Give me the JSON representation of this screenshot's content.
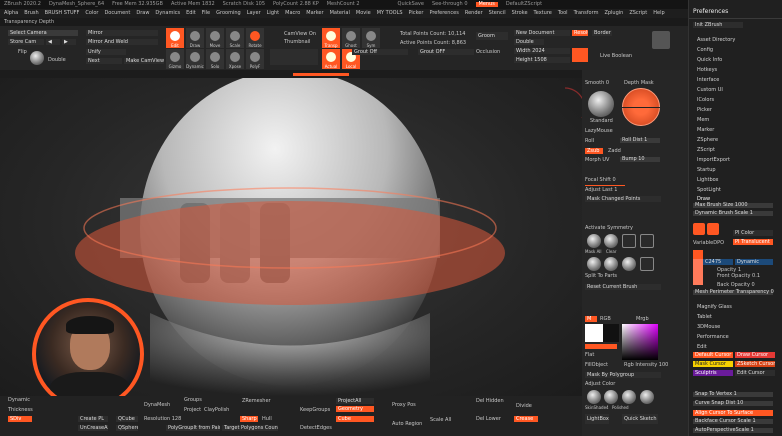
{
  "titlebar": {
    "items": [
      "ZBrush 2020.2",
      "DynaMesh_Sphere_64",
      "Free Mem 32.935GB",
      "Active Mem 1832",
      "Scratch Disk 105",
      "PolyCount 2.88 KP",
      "MeshCount 2"
    ],
    "quicksave": "QuickSave",
    "see_through": "See-through 0",
    "menus": "Menus",
    "default_script": "DefaultZScript"
  },
  "menubar": {
    "items": [
      "Alpha",
      "Brush",
      "BRUSH STUFF",
      "Color",
      "Document",
      "Draw",
      "Dynamics",
      "Edit",
      "File",
      "Grooming",
      "Layer",
      "Light",
      "Macro",
      "Marker",
      "Material",
      "Movie",
      "MY TOOLS",
      "Picker",
      "Preferences",
      "Render",
      "Stencil",
      "Stroke",
      "Texture",
      "Tool",
      "Transform",
      "Zplugin",
      "ZScript",
      "Help"
    ]
  },
  "subbar": {
    "label": "Transparency Depth"
  },
  "toptools": {
    "select_camera": "Select Camera",
    "store_cam": "Store Cam",
    "flip": "Flip",
    "double": "Double",
    "mirror": "Mirror",
    "mirror_weld": "Mirror And Weld",
    "unify": "Unify",
    "next": "Next",
    "make_camview": "Make CamView",
    "camview_on": "CamView On",
    "thumbnail": "Thumbnail",
    "total_points": "Total Points Count: 10,114",
    "active_points": "Active Points Count: 8,863",
    "grooming": "Groom",
    "resolution": "Resolution",
    "new_document": "New Document",
    "border": "Border",
    "width": "Width 2024",
    "height": "Height 1508",
    "live_boolean": "Live Boolean",
    "grout": "Grout Off",
    "grout2": "Grout OFF",
    "tool_labels": [
      "Edit",
      "Draw",
      "Move",
      "Scale",
      "Rotate",
      "Gizmo",
      "Dynamic",
      "Solo",
      "Xpose",
      "PolyF",
      "Transp",
      "Ghost",
      "Actual",
      "Local",
      "Sym"
    ],
    "occlusion": "Occlusion",
    "double2": "Double"
  },
  "rshelf": {
    "groups": "Smooth 0",
    "depth_mask": "Depth Mask",
    "standard": "Standard",
    "lazy_mouse": "LazyMouse",
    "roll": "Roll",
    "roll_dist": "Roll Dist 1",
    "zsub": "Zsub",
    "zadd": "Zadd",
    "morph_uv": "Morph UV",
    "bump": "Bump 10",
    "focal_shift": "Focal Shift 0",
    "adjust_last": "Adjust Last 1",
    "mask_changed": "Mask Changed Points",
    "activate_symmetry": "Activate Symmetry",
    "mask_all": "Mask All",
    "clear": "Clear",
    "sel_lasso": "SelectLasso",
    "sel_rect": "SelectRect",
    "clip_curve": "ClipCurve",
    "split_to_parts": "Split To Parts",
    "reset_current_brush": "Reset Current Brush",
    "rgb": "RGB",
    "mrgb": "Mrgb",
    "m": "M",
    "fill_object": "FillObject",
    "rgb_intensity": "Rgb Intensity 100",
    "mask_by_polygroup": "Mask By Polygroup",
    "adjust_color": "Adjust Color",
    "lightbox": "LightBox",
    "quick_sketch": "Quick Sketch",
    "materials": [
      "SkinShade4",
      "Polished",
      "BasicMat",
      "BasicMat2"
    ],
    "gradient": "Gradient",
    "flat": "Flat",
    "split": "Split",
    "subtool_label": "Sculptris Pro",
    "alpha_label": "Alpha Off",
    "dots": "Dots"
  },
  "prefs": {
    "title": "Preferences",
    "items": [
      "Init ZBrush",
      "Asset Directory",
      "Config",
      "Quick Info",
      "Hotkeys",
      "Interface",
      "Custom UI",
      "IColors",
      "Picker",
      "Mem",
      "Marker",
      "ZSphere",
      "ZScript",
      "ImportExport",
      "Startup",
      "Lightbox",
      "SpotLight",
      "Draw"
    ],
    "draw_items": [
      "Max Brush Size 1000",
      "Dynamic Brush Scale 1",
      "PI Color",
      "VariableDPO",
      "PI Translucent",
      "Opacity 1",
      "Front Opacity 0.1",
      "Back Opacity 0",
      "Mesh Perimeter Transparency 0"
    ],
    "more": [
      "Magnify Glass",
      "Tablet",
      "3DMouse",
      "Performance",
      "Edit"
    ],
    "cursor_items": [
      "Default Cursor",
      "Draw Cursor",
      "Mask Cursor",
      "ZSketch Cursor",
      "Sculptris",
      "Edit Cursor"
    ],
    "bottom": [
      "Snap To Vertex 1",
      "Curve Snap Dist 10",
      "Align Cursor To Surface",
      "Backface Cursor Scale 1",
      "AutoPerspectiveScale 1"
    ],
    "c2475": "C2475",
    "dynamic": "Dynamic"
  },
  "bottom": {
    "dynamic": "Dynamic",
    "thickness": "Thickness",
    "sdiv": "SDiv",
    "create_pl": "Create PL",
    "qcube": "QCube",
    "groups": "Groups",
    "project": "Project",
    "clay_polish": "ClayPolish",
    "zremesher": "ZRemesher",
    "keep_groups": "KeepGroups",
    "polygroup_from_paint": "PolyGroupIt from Paint",
    "target_polygons": "Target Polygons Count 5",
    "project_all": "ProjectAll",
    "geometry": "Geometry",
    "cube": "Cube",
    "proxy_pos": "Proxy Pos",
    "auto_region": "Auto Region",
    "del_hidden": "Del Hidden",
    "del_lower": "Del Lower",
    "divide": "Divide",
    "scale_all": "Scale All",
    "sharp": "Sharp",
    "hull": "Hull",
    "dynamesh": "DynaMesh",
    "resolution": "Resolution 128",
    "crease": "Crease",
    "uncrease": "UnCreaseAll",
    "qsphere": "QSphere",
    "detect_edges": "DetectEdges"
  },
  "colors": {
    "accent": "#ff5722",
    "bg": "#1b1b1b",
    "panel": "#262626"
  }
}
